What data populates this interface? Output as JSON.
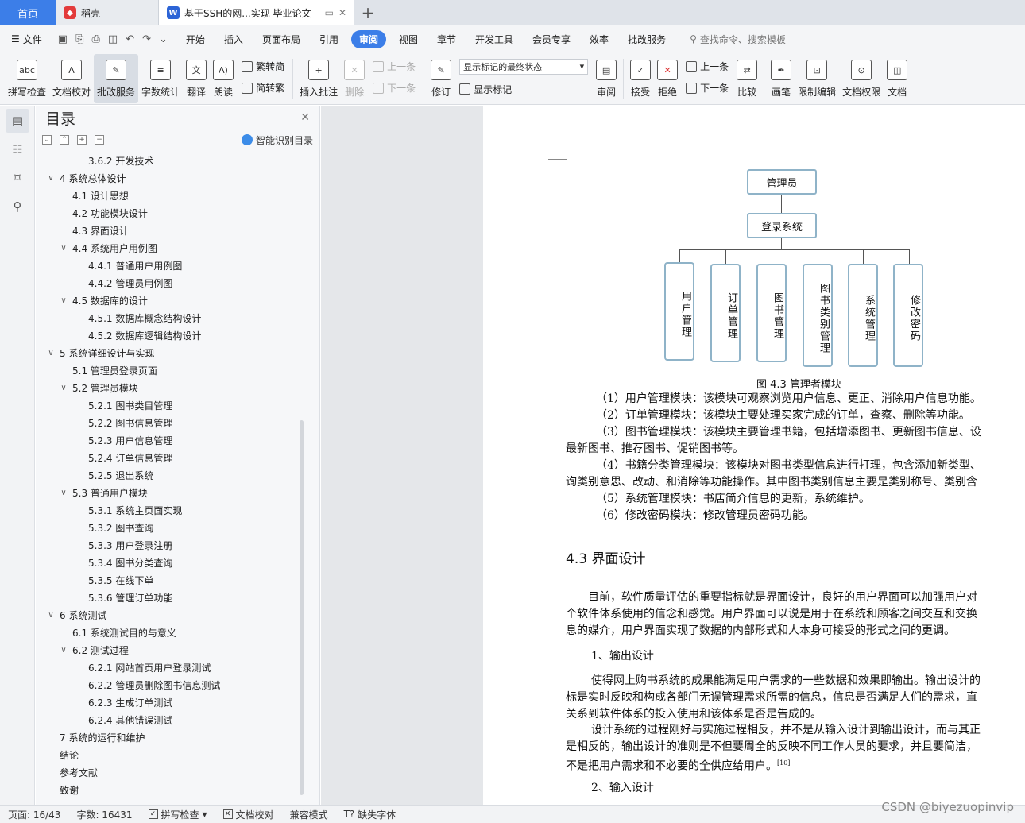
{
  "tabs": {
    "home": "首页",
    "daoke": "稻壳",
    "document": "基于SSH的网...实现 毕业论文",
    "add_icon": "plus-icon"
  },
  "menubar": {
    "file": "文件",
    "items": [
      "开始",
      "插入",
      "页面布局",
      "引用",
      "审阅",
      "视图",
      "章节",
      "开发工具",
      "会员专享",
      "效率",
      "批改服务"
    ],
    "active": "审阅",
    "search": "查找命令、搜索模板"
  },
  "ribbon": {
    "spell_check": "拼写检查",
    "doc_proof": "文档校对",
    "grading": "批改服务",
    "word_count": "字数统计",
    "translate": "翻译",
    "read_aloud": "朗读",
    "trad_to_simp": "繁转简",
    "simp_to_trad": "简转繁",
    "insert_comment": "插入批注",
    "delete": "删除",
    "prev_comment": "上一条",
    "next_comment": "下一条",
    "revise": "修订",
    "markup_state": "显示标记的最终状态",
    "show_markup": "显示标记",
    "review": "审阅",
    "accept": "接受",
    "reject": "拒绝",
    "prev_change": "上一条",
    "next_change": "下一条",
    "compare": "比较",
    "pen": "画笔",
    "restrict_edit": "限制编辑",
    "doc_permission": "文档权限",
    "doc_more": "文档"
  },
  "toc": {
    "title": "目录",
    "smart": "智能识别目录",
    "items": [
      {
        "text": "3.6.2  开发技术",
        "level": 3,
        "toggle": ""
      },
      {
        "text": "4    系统总体设计",
        "level": 1,
        "toggle": "v"
      },
      {
        "text": "4.1  设计思想",
        "level": 2,
        "toggle": ""
      },
      {
        "text": "4.2  功能模块设计",
        "level": 2,
        "toggle": ""
      },
      {
        "text": "4.3  界面设计",
        "level": 2,
        "toggle": ""
      },
      {
        "text": "4.4  系统用户用例图",
        "level": 2,
        "toggle": "v"
      },
      {
        "text": "4.4.1  普通用户用例图",
        "level": 3,
        "toggle": ""
      },
      {
        "text": "4.4.2  管理员用例图",
        "level": 3,
        "toggle": ""
      },
      {
        "text": "4.5    数据库的设计",
        "level": 2,
        "toggle": "v"
      },
      {
        "text": "4.5.1  数据库概念结构设计",
        "level": 3,
        "toggle": ""
      },
      {
        "text": "4.5.2    数据库逻辑结构设计",
        "level": 3,
        "toggle": ""
      },
      {
        "text": "5    系统详细设计与实现",
        "level": 1,
        "toggle": "v"
      },
      {
        "text": "5.1  管理员登录页面",
        "level": 2,
        "toggle": ""
      },
      {
        "text": "5.2  管理员模块",
        "level": 2,
        "toggle": "v"
      },
      {
        "text": "5.2.1  图书类目管理",
        "level": 3,
        "toggle": ""
      },
      {
        "text": "5.2.2  图书信息管理",
        "level": 3,
        "toggle": ""
      },
      {
        "text": "5.2.3  用户信息管理",
        "level": 3,
        "toggle": ""
      },
      {
        "text": "5.2.4  订单信息管理",
        "level": 3,
        "toggle": ""
      },
      {
        "text": "5.2.5  退出系统",
        "level": 3,
        "toggle": ""
      },
      {
        "text": "5.3  普通用户模块",
        "level": 2,
        "toggle": "v"
      },
      {
        "text": "5.3.1  系统主页面实现",
        "level": 3,
        "toggle": ""
      },
      {
        "text": "5.3.2  图书查询",
        "level": 3,
        "toggle": ""
      },
      {
        "text": "5.3.3  用户登录注册",
        "level": 3,
        "toggle": ""
      },
      {
        "text": "5.3.4  图书分类查询",
        "level": 3,
        "toggle": ""
      },
      {
        "text": "5.3.5  在线下单",
        "level": 3,
        "toggle": ""
      },
      {
        "text": "5.3.6  管理订单功能",
        "level": 3,
        "toggle": ""
      },
      {
        "text": "6    系统测试",
        "level": 1,
        "toggle": "v"
      },
      {
        "text": "6.1  系统测试目的与意义",
        "level": 2,
        "toggle": ""
      },
      {
        "text": "6.2  测试过程",
        "level": 2,
        "toggle": "v"
      },
      {
        "text": "6.2.1  网站首页用户登录测试",
        "level": 3,
        "toggle": ""
      },
      {
        "text": "6.2.2  管理员删除图书信息测试",
        "level": 3,
        "toggle": ""
      },
      {
        "text": "6.2.3  生成订单测试",
        "level": 3,
        "toggle": ""
      },
      {
        "text": "6.2.4  其他错误测试",
        "level": 3,
        "toggle": ""
      },
      {
        "text": "7    系统的运行和维护",
        "level": 1,
        "toggle": ""
      },
      {
        "text": "结论",
        "level": 1,
        "toggle": ""
      },
      {
        "text": "参考文献",
        "level": 1,
        "toggle": ""
      },
      {
        "text": "致谢",
        "level": 1,
        "toggle": ""
      }
    ]
  },
  "diagram": {
    "root": "管理员",
    "login": "登录系统",
    "modules": [
      "用户管理",
      "订单管理",
      "图书管理",
      "图书类别管理",
      "系统管理",
      "修改密码"
    ],
    "caption": "图 4.3   管理者模块"
  },
  "body": {
    "p1": "（1）用户管理模块：该模块可观察浏览用户信息、更正、消除用户信息功能。",
    "p2": "（2）订单管理模块：该模块主要处理买家完成的订单，查察、删除等功能。",
    "p3a": "（3）图书管理模块：该模块主要管理书籍，包括增添图书、更新图书信息、设",
    "p3b": "最新图书、推荐图书、促销图书等。",
    "p4a": "（4）书籍分类管理模块：该模块对图书类型信息进行打理，包含添加新类型、",
    "p4b": "询类别意思、改动、和消除等功能操作。其中图书类别信息主要是类别称号、类别含",
    "p5": "（5）系统管理模块：书店简介信息的更新，系统维护。",
    "p6": "（6）修改密码模块：修改管理员密码功能。",
    "heading": "4.3  界面设计",
    "p7a": "目前，软件质量评估的重要指标就是界面设计，良好的用户界面可以加强用户对",
    "p7b": "个软件体系使用的信念和感觉。用户界面可以说是用于在系统和顾客之间交互和交换",
    "p7c": "息的媒介，用户界面实现了数据的内部形式和人本身可接受的形式之间的更调。",
    "sub1": "1、输出设计",
    "p8a": "使得网上购书系统的成果能满足用户需求的一些数据和效果即输出。输出设计的",
    "p8b": "标是实时反映和构成各部门无误管理需求所需的信息，信息是否满足人们的需求，直",
    "p8c": "关系到软件体系的投入使用和该体系是否是告成的。",
    "p9a": "设计系统的过程刚好与实施过程相反，并不是从输入设计到输出设计，而与其正",
    "p9b": "是相反的，输出设计的准则是不但要周全的反映不同工作人员的要求，并且要简洁，",
    "p9c": "不是把用户需求和不必要的全供应给用户。",
    "cite": "[10]",
    "sub2": "2、输入设计"
  },
  "status": {
    "page": "页面: 16/43",
    "words": "字数: 16431",
    "spell": "拼写检查",
    "proof": "文档校对",
    "compat": "兼容模式",
    "missing_font": "缺失字体"
  },
  "watermark": "CSDN @biyezuopinvip"
}
